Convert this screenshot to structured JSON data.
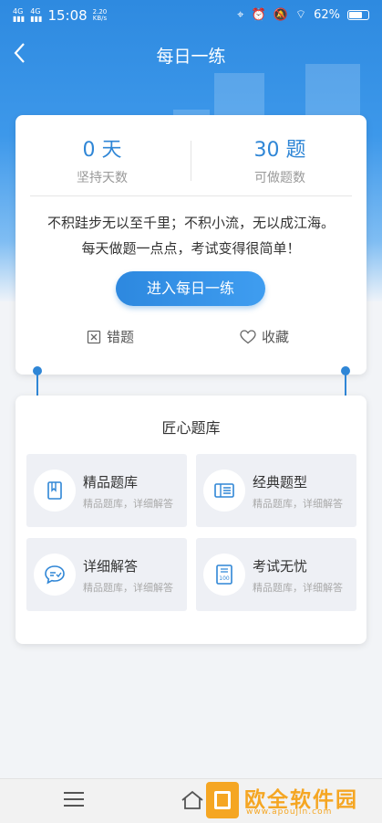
{
  "status_bar": {
    "signal1": "4G",
    "signal2": "4G",
    "time": "15:08",
    "speed_value": "2.20",
    "speed_unit": "KB/s",
    "battery": "62%"
  },
  "header": {
    "title": "每日一练"
  },
  "stats": {
    "days_value": "0 天",
    "days_label": "坚持天数",
    "questions_value": "30 题",
    "questions_label": "可做题数"
  },
  "quote": "不积跬步无以至千里；不积小流，无以成江海。每天做题一点点，考试变得很简单！",
  "enter_button": "进入每日一练",
  "actions": {
    "wrong": "错题",
    "favorite": "收藏"
  },
  "section": {
    "title": "匠心题库",
    "tiles": [
      {
        "title": "精品题库",
        "desc": "精品题库，详细解答",
        "icon": "book-icon"
      },
      {
        "title": "经典题型",
        "desc": "精品题库，详细解答",
        "icon": "ticket-icon"
      },
      {
        "title": "详细解答",
        "desc": "精品题库，详细解答",
        "icon": "chat-check-icon"
      },
      {
        "title": "考试无忧",
        "desc": "精品题库，详细解答",
        "icon": "score-100-icon"
      }
    ]
  },
  "watermark": {
    "name": "欧全软件园",
    "url": "www.apoujin.com"
  },
  "colors": {
    "accent": "#2f86d6",
    "watermark": "#f5a623"
  }
}
